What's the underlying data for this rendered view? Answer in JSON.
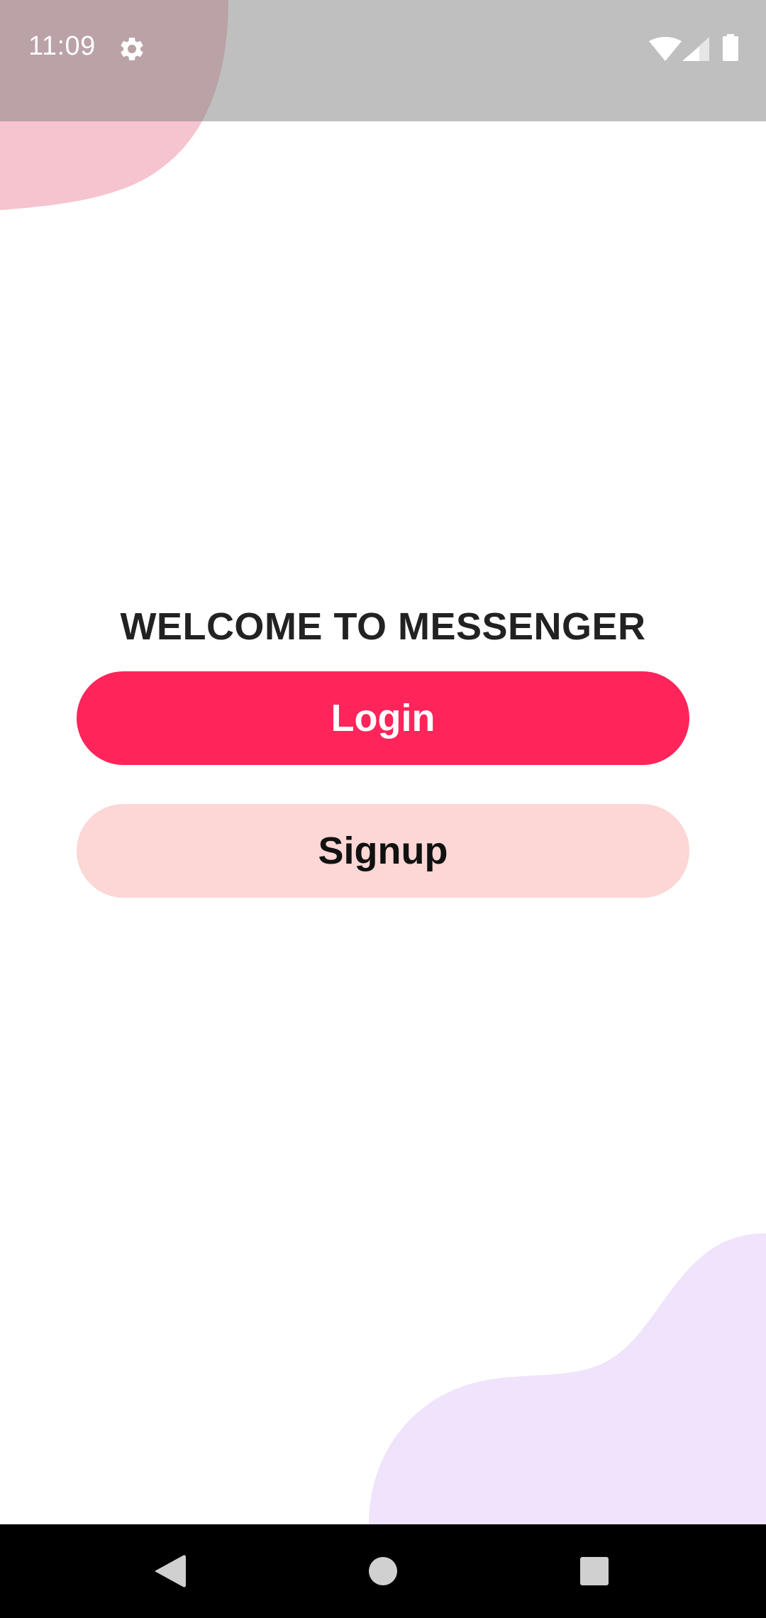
{
  "status_bar": {
    "time": "11:09",
    "icons": [
      "gear-icon",
      "wifi-icon",
      "signal-icon",
      "battery-icon"
    ]
  },
  "welcome": {
    "title": "WELCOME TO MESSENGER"
  },
  "buttons": {
    "login_label": "Login",
    "signup_label": "Signup"
  },
  "nav_bar": {
    "icons": [
      "back-icon",
      "home-icon",
      "recents-icon"
    ]
  },
  "colors": {
    "accent": "#ff245a",
    "signup_background": "#fdd6d6",
    "top_blob": "#f5c4cf",
    "bottom_blob": "#efe4fc",
    "status_bar_overlay": "#808080",
    "nav_bar": "#000000"
  }
}
